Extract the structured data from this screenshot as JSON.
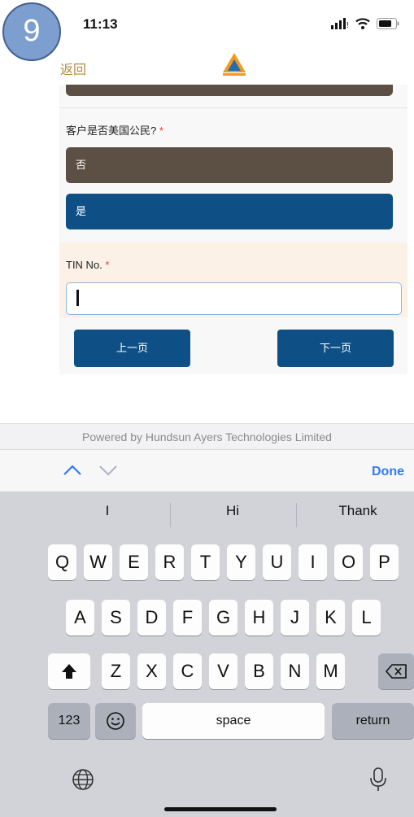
{
  "badge": {
    "step": "9"
  },
  "status": {
    "time": "11:13"
  },
  "nav": {
    "back": "返回"
  },
  "form": {
    "question": "客户是否美国公民?",
    "required_mark": "*",
    "options": [
      "否",
      "是"
    ],
    "tin_label": "TIN No.",
    "tin_value": "",
    "prev_button": "上一页",
    "next_button": "下一页"
  },
  "footer": {
    "powered": "Powered by Hundsun Ayers Technologies Limited"
  },
  "keyboard": {
    "done": "Done",
    "suggestions": [
      "I",
      "Hi",
      "Thank"
    ],
    "row1": [
      "Q",
      "W",
      "E",
      "R",
      "T",
      "Y",
      "U",
      "I",
      "O",
      "P"
    ],
    "row2": [
      "A",
      "S",
      "D",
      "F",
      "G",
      "H",
      "J",
      "K",
      "L"
    ],
    "row3": [
      "Z",
      "X",
      "C",
      "V",
      "B",
      "N",
      "M"
    ],
    "numbers": "123",
    "space": "space",
    "return": "return"
  },
  "colors": {
    "option_no": "#5c4f43",
    "option_selected": "#0e5086",
    "accent_blue": "#2f7bf5",
    "tin_bg": "#fbf1e6"
  },
  "icons": [
    "status-signal-icon",
    "wifi-icon",
    "battery-icon",
    "app-logo",
    "chevron-up-icon",
    "chevron-down-icon",
    "shift-icon",
    "backspace-icon",
    "emoji-icon",
    "globe-icon",
    "microphone-icon"
  ]
}
